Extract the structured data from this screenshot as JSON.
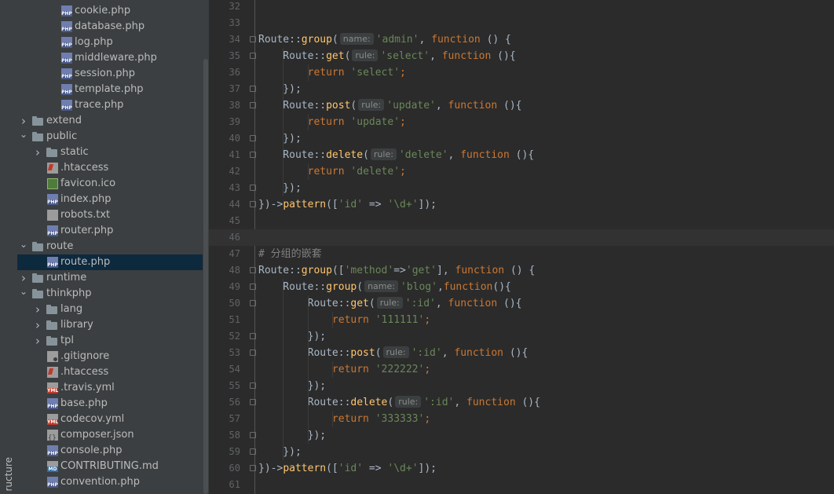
{
  "sidebar": {
    "vertical_label": "ructure"
  },
  "tree": [
    {
      "label": "cookie.php",
      "type": "php",
      "expanded": null
    },
    {
      "label": "database.php",
      "type": "php",
      "expanded": null
    },
    {
      "label": "log.php",
      "type": "php",
      "expanded": null
    },
    {
      "label": "middleware.php",
      "type": "php",
      "expanded": null
    },
    {
      "label": "session.php",
      "type": "php",
      "expanded": null
    },
    {
      "label": "template.php",
      "type": "php",
      "expanded": null
    },
    {
      "label": "trace.php",
      "type": "php",
      "expanded": null
    },
    {
      "label": "extend",
      "type": "folder",
      "expanded": false
    },
    {
      "label": "public",
      "type": "folder",
      "expanded": true
    },
    {
      "label": "static",
      "type": "folder",
      "expanded": false
    },
    {
      "label": ".htaccess",
      "type": "ht",
      "expanded": null
    },
    {
      "label": "favicon.ico",
      "type": "ico",
      "expanded": null
    },
    {
      "label": "index.php",
      "type": "php",
      "expanded": null
    },
    {
      "label": "robots.txt",
      "type": "txt",
      "expanded": null
    },
    {
      "label": "router.php",
      "type": "php",
      "expanded": null
    },
    {
      "label": "route",
      "type": "folder",
      "expanded": true
    },
    {
      "label": "route.php",
      "type": "php",
      "expanded": null,
      "selected": true
    },
    {
      "label": "runtime",
      "type": "folder",
      "expanded": false
    },
    {
      "label": "thinkphp",
      "type": "folder",
      "expanded": true
    },
    {
      "label": "lang",
      "type": "folder",
      "expanded": false
    },
    {
      "label": "library",
      "type": "folder",
      "expanded": false
    },
    {
      "label": "tpl",
      "type": "folder",
      "expanded": false
    },
    {
      "label": ".gitignore",
      "type": "git",
      "expanded": null
    },
    {
      "label": ".htaccess",
      "type": "ht",
      "expanded": null
    },
    {
      "label": ".travis.yml",
      "type": "yml",
      "expanded": null
    },
    {
      "label": "base.php",
      "type": "php",
      "expanded": null
    },
    {
      "label": "codecov.yml",
      "type": "yml",
      "expanded": null
    },
    {
      "label": "composer.json",
      "type": "json",
      "expanded": null
    },
    {
      "label": "console.php",
      "type": "php",
      "expanded": null
    },
    {
      "label": "CONTRIBUTING.md",
      "type": "md",
      "expanded": null
    },
    {
      "label": "convention.php",
      "type": "php",
      "expanded": null
    }
  ],
  "editor": {
    "current_line": "46",
    "lines": [
      {
        "no": "32",
        "fold": false,
        "tokens": []
      },
      {
        "no": "33",
        "fold": false,
        "tokens": []
      },
      {
        "no": "34",
        "fold": true,
        "tokens": [
          [
            "def",
            "Route::"
          ],
          [
            "fn",
            "group"
          ],
          [
            "def",
            "("
          ],
          [
            "hint",
            "name:"
          ],
          [
            "str",
            "'admin'"
          ],
          [
            "def",
            ", "
          ],
          [
            "kw",
            "function"
          ],
          [
            "def",
            " () {"
          ]
        ]
      },
      {
        "no": "35",
        "fold": true,
        "tokens": [
          [
            "def",
            "    Route::"
          ],
          [
            "fn",
            "get"
          ],
          [
            "def",
            "("
          ],
          [
            "hint",
            "rule:"
          ],
          [
            "str",
            "'select'"
          ],
          [
            "def",
            ", "
          ],
          [
            "kw",
            "function"
          ],
          [
            "def",
            " (){"
          ]
        ]
      },
      {
        "no": "36",
        "fold": false,
        "tokens": [
          [
            "def",
            "        "
          ],
          [
            "kw",
            "return "
          ],
          [
            "str",
            "'select'"
          ],
          [
            "kw",
            ";"
          ]
        ]
      },
      {
        "no": "37",
        "fold": true,
        "tokens": [
          [
            "def",
            "    });"
          ]
        ]
      },
      {
        "no": "38",
        "fold": true,
        "tokens": [
          [
            "def",
            "    Route::"
          ],
          [
            "fn",
            "post"
          ],
          [
            "def",
            "("
          ],
          [
            "hint",
            "rule:"
          ],
          [
            "str",
            "'update'"
          ],
          [
            "def",
            ", "
          ],
          [
            "kw",
            "function"
          ],
          [
            "def",
            " (){"
          ]
        ]
      },
      {
        "no": "39",
        "fold": false,
        "tokens": [
          [
            "def",
            "        "
          ],
          [
            "kw",
            "return "
          ],
          [
            "str",
            "'update'"
          ],
          [
            "kw",
            ";"
          ]
        ]
      },
      {
        "no": "40",
        "fold": true,
        "tokens": [
          [
            "def",
            "    });"
          ]
        ]
      },
      {
        "no": "41",
        "fold": true,
        "tokens": [
          [
            "def",
            "    Route::"
          ],
          [
            "fn",
            "delete"
          ],
          [
            "def",
            "("
          ],
          [
            "hint",
            "rule:"
          ],
          [
            "str",
            "'delete'"
          ],
          [
            "def",
            ", "
          ],
          [
            "kw",
            "function"
          ],
          [
            "def",
            " (){"
          ]
        ]
      },
      {
        "no": "42",
        "fold": false,
        "tokens": [
          [
            "def",
            "        "
          ],
          [
            "kw",
            "return "
          ],
          [
            "str",
            "'delete'"
          ],
          [
            "kw",
            ";"
          ]
        ]
      },
      {
        "no": "43",
        "fold": true,
        "tokens": [
          [
            "def",
            "    });"
          ]
        ]
      },
      {
        "no": "44",
        "fold": true,
        "tokens": [
          [
            "def",
            "})->"
          ],
          [
            "fn",
            "pattern"
          ],
          [
            "def",
            "(["
          ],
          [
            "str",
            "'id'"
          ],
          [
            "def",
            " => "
          ],
          [
            "str",
            "'\\d+'"
          ],
          [
            "def",
            "]);"
          ]
        ]
      },
      {
        "no": "45",
        "fold": false,
        "tokens": []
      },
      {
        "no": "46",
        "fold": false,
        "tokens": []
      },
      {
        "no": "47",
        "fold": false,
        "tokens": [
          [
            "cmt",
            "# 分组的嵌套"
          ]
        ]
      },
      {
        "no": "48",
        "fold": true,
        "tokens": [
          [
            "def",
            "Route::"
          ],
          [
            "fn",
            "group"
          ],
          [
            "def",
            "(["
          ],
          [
            "str",
            "'method'"
          ],
          [
            "def",
            "=>"
          ],
          [
            "str",
            "'get'"
          ],
          [
            "def",
            "], "
          ],
          [
            "kw",
            "function"
          ],
          [
            "def",
            " () {"
          ]
        ]
      },
      {
        "no": "49",
        "fold": true,
        "tokens": [
          [
            "def",
            "    Route::"
          ],
          [
            "fn",
            "group"
          ],
          [
            "def",
            "("
          ],
          [
            "hint",
            "name:"
          ],
          [
            "str",
            "'blog'"
          ],
          [
            "def",
            ","
          ],
          [
            "kw",
            "function"
          ],
          [
            "def",
            "(){"
          ]
        ]
      },
      {
        "no": "50",
        "fold": true,
        "tokens": [
          [
            "def",
            "        Route::"
          ],
          [
            "fn",
            "get"
          ],
          [
            "def",
            "("
          ],
          [
            "hint",
            "rule:"
          ],
          [
            "str",
            "':id'"
          ],
          [
            "def",
            ", "
          ],
          [
            "kw",
            "function"
          ],
          [
            "def",
            " (){"
          ]
        ]
      },
      {
        "no": "51",
        "fold": false,
        "tokens": [
          [
            "def",
            "            "
          ],
          [
            "kw",
            "return "
          ],
          [
            "str",
            "'111111'"
          ],
          [
            "kw",
            ";"
          ]
        ]
      },
      {
        "no": "52",
        "fold": true,
        "tokens": [
          [
            "def",
            "        });"
          ]
        ]
      },
      {
        "no": "53",
        "fold": true,
        "tokens": [
          [
            "def",
            "        Route::"
          ],
          [
            "fn",
            "post"
          ],
          [
            "def",
            "("
          ],
          [
            "hint",
            "rule:"
          ],
          [
            "str",
            "':id'"
          ],
          [
            "def",
            ", "
          ],
          [
            "kw",
            "function"
          ],
          [
            "def",
            " (){"
          ]
        ]
      },
      {
        "no": "54",
        "fold": false,
        "tokens": [
          [
            "def",
            "            "
          ],
          [
            "kw",
            "return "
          ],
          [
            "str",
            "'222222'"
          ],
          [
            "kw",
            ";"
          ]
        ]
      },
      {
        "no": "55",
        "fold": true,
        "tokens": [
          [
            "def",
            "        });"
          ]
        ]
      },
      {
        "no": "56",
        "fold": true,
        "tokens": [
          [
            "def",
            "        Route::"
          ],
          [
            "fn",
            "delete"
          ],
          [
            "def",
            "("
          ],
          [
            "hint",
            "rule:"
          ],
          [
            "str",
            "':id'"
          ],
          [
            "def",
            ", "
          ],
          [
            "kw",
            "function"
          ],
          [
            "def",
            " (){"
          ]
        ]
      },
      {
        "no": "57",
        "fold": false,
        "tokens": [
          [
            "def",
            "            "
          ],
          [
            "kw",
            "return "
          ],
          [
            "str",
            "'333333'"
          ],
          [
            "kw",
            ";"
          ]
        ]
      },
      {
        "no": "58",
        "fold": true,
        "tokens": [
          [
            "def",
            "        });"
          ]
        ]
      },
      {
        "no": "59",
        "fold": true,
        "tokens": [
          [
            "def",
            "    });"
          ]
        ]
      },
      {
        "no": "60",
        "fold": true,
        "tokens": [
          [
            "def",
            "})->"
          ],
          [
            "fn",
            "pattern"
          ],
          [
            "def",
            "(["
          ],
          [
            "str",
            "'id'"
          ],
          [
            "def",
            " => "
          ],
          [
            "str",
            "'\\d+'"
          ],
          [
            "def",
            "]);"
          ]
        ]
      },
      {
        "no": "61",
        "fold": false,
        "tokens": []
      }
    ]
  },
  "colors": {
    "background": "#2b2b2b",
    "panel": "#3c3f41",
    "selection": "#0d293e",
    "keyword": "#cc7832",
    "function": "#ffc66d",
    "string": "#6a8759",
    "comment": "#808080",
    "text": "#a9b7c6"
  }
}
